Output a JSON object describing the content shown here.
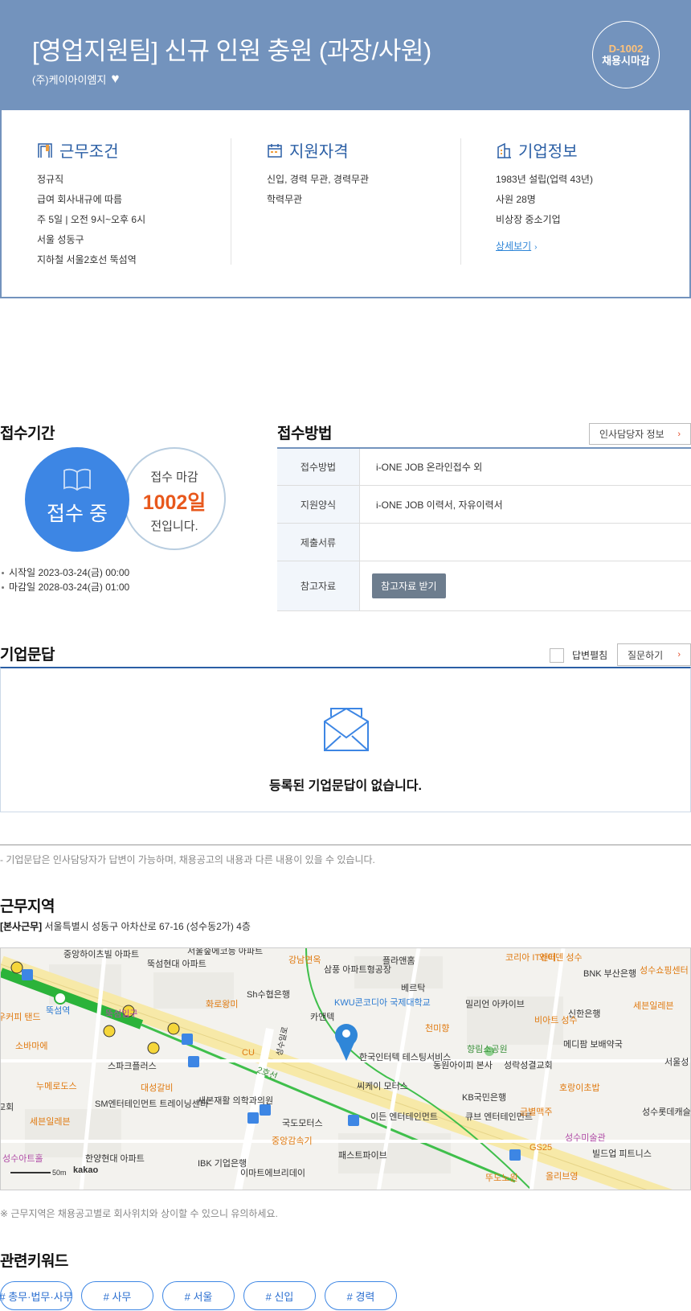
{
  "header": {
    "title": "[영업지원팀] 신규 인원 충원 (과장/사원)",
    "company": "(주)케이아이엠지",
    "dday_code": "D-1002",
    "dday_label": "채용시마감"
  },
  "info": {
    "work": {
      "title": "근무조건",
      "lines": [
        "정규직",
        "급여 회사내규에 따름",
        "주 5일 | 오전 9시~오후 6시",
        "서울 성동구",
        "지하철 서울2호선 뚝섬역"
      ]
    },
    "qualification": {
      "title": "지원자격",
      "lines": [
        "신입, 경력 무관, 경력무관",
        "학력무관"
      ]
    },
    "company": {
      "title": "기업정보",
      "lines": [
        "1983년 설립(업력 43년)",
        "사원 28명",
        "비상장 중소기업"
      ],
      "more": "상세보기"
    }
  },
  "period": {
    "title": "접수기간",
    "status": "접수 중",
    "deadline_prefix": "접수 마감",
    "deadline_days": "1002일",
    "deadline_suffix": "전입니다.",
    "start": "시작일 2023-03-24(금) 00:00",
    "end": "마감일 2028-03-24(금) 01:00"
  },
  "method": {
    "title": "접수방법",
    "manager_button": "인사담당자 정보",
    "rows": [
      {
        "label": "접수방법",
        "value": "i-ONE JOB 온라인접수 외"
      },
      {
        "label": "지원양식",
        "value": "i-ONE JOB 이력서, 자유이력서"
      },
      {
        "label": "제출서류",
        "value": ""
      },
      {
        "label": "참고자료",
        "value": ""
      }
    ],
    "download_button": "참고자료 받기"
  },
  "qa": {
    "title": "기업문답",
    "expand_label": "답변펼침",
    "ask_button": "질문하기",
    "empty_message": "등록된 기업문답이 없습니다.",
    "note": "- 기업문답은 인사담당자가 답변이 가능하며, 채용공고의 내용과 다른 내용이 있을 수 있습니다."
  },
  "location": {
    "title": "근무지역",
    "address_tag": "[본사근무]",
    "address": "서울특별시 성동구 아차산로 67-16 (성수동2가) 4층",
    "note": "※ 근무지역은 채용공고별로 회사위치와 상이할 수 있으니 유의하세요.",
    "map_scale": "50m",
    "map_brand": "kakao",
    "map_labels": [
      "중앙하이츠빌 아파트",
      "뚝섬현대 아파트",
      "서울숲에코등 아파트",
      "강남면옥",
      "삼풍 아파트형공장",
      "플라앤홈",
      "베르탁",
      "코리아 IT센터",
      "와이덴 성수",
      "BNK 부산은행",
      "성수쇼핑센터",
      "Sh수협은행",
      "화로왕미",
      "KWU콘코디아 국제대학교",
      "카앤텍",
      "밀리언 아카이브",
      "신한은행",
      "세븐일레븐",
      "천미향",
      "비아트 성수",
      "향림소공원",
      "메디팜 보배약국",
      "한국인터텍 테스팅서비스",
      "동원아이피 본사",
      "성락성결교회",
      "서울성 우편취",
      "뚝섬역",
      "뚝섬입구",
      "스파크플러스",
      "CU",
      "소바마에",
      "누메로도스",
      "대성갈비",
      "씨케이 모터스",
      "호랑이초밥",
      "KB국민은행",
      "SM엔터테인먼트 트레이닝센터",
      "새본재활 의학과의원",
      "국도모터스",
      "이든 엔터테인먼트",
      "큐브 엔터테인먼트",
      "금별맥주",
      "성수롯데캐슬 파크아파트",
      "세븐일레븐",
      "중앙감속기",
      "성수미술관",
      "GS25",
      "패스트파이브",
      "빌드업 피트니스",
      "성수아트홀",
      "한양현대 아파트",
      "IBK 기업은행",
      "이마트에브리데이",
      "올리브영",
      "뚜도노원",
      "우커피 탠드",
      "교회",
      "2호선",
      "성수일로"
    ]
  },
  "keywords": {
    "title": "관련키워드",
    "items": [
      "# 총무·법무·사무",
      "# 사무",
      "# 서울",
      "# 신입",
      "# 경력"
    ]
  },
  "colors": {
    "header_bg": "#7393bd",
    "accent_blue": "#3d86e4",
    "deadline_orange": "#e8581c",
    "section_blue": "#2b5fa5"
  }
}
